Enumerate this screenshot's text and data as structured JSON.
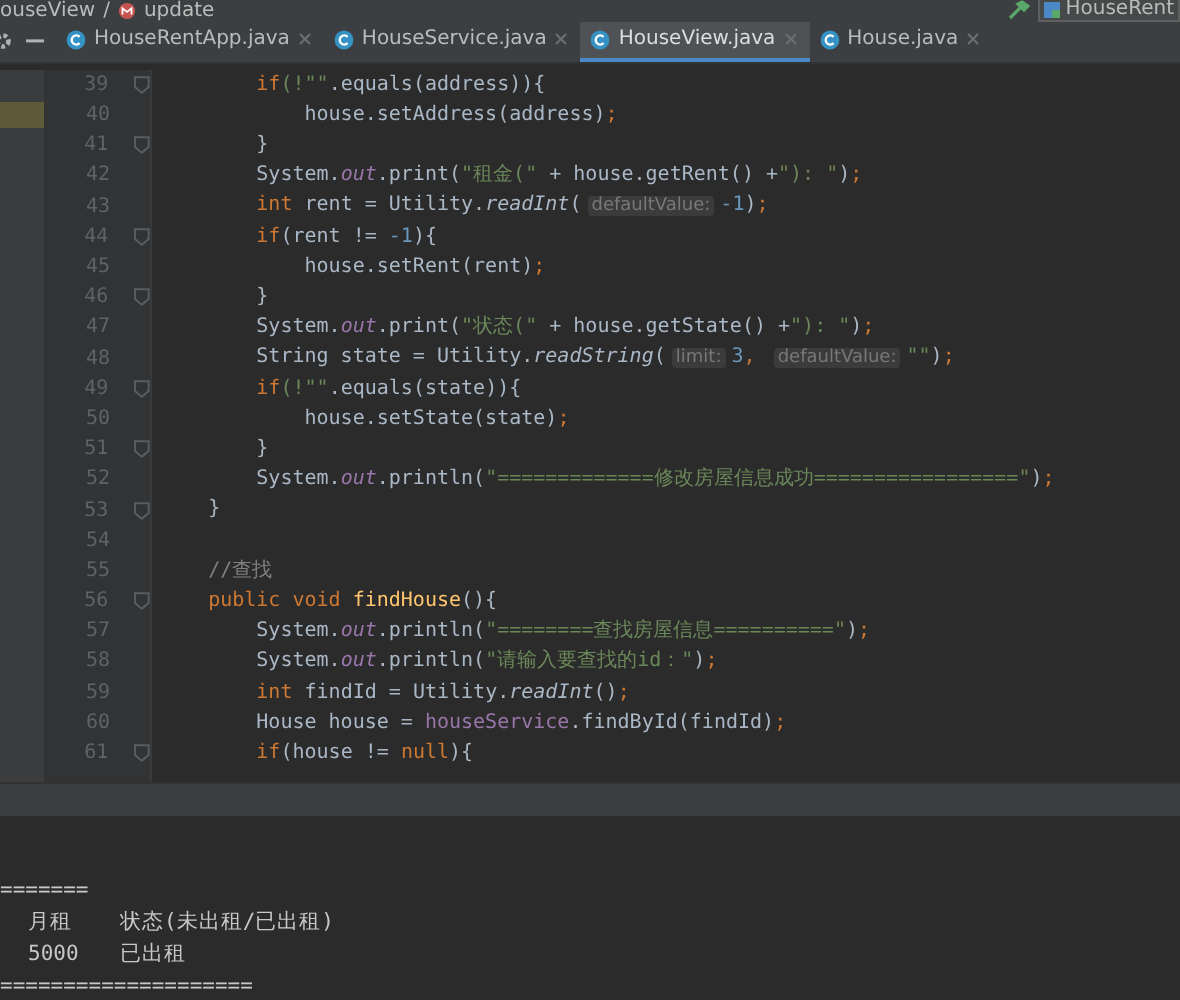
{
  "breadcrumb": {
    "items": [
      {
        "text": "ouseView",
        "kind": "class"
      },
      {
        "text": "update",
        "kind": "method"
      }
    ],
    "separator": "/",
    "run_config": "HouseRent"
  },
  "tabs": [
    {
      "label": "HouseRentApp.java",
      "selected": false
    },
    {
      "label": "HouseService.java",
      "selected": false
    },
    {
      "label": "HouseView.java",
      "selected": true
    },
    {
      "label": "House.java",
      "selected": false
    }
  ],
  "editor": {
    "lines": [
      {
        "number": "39",
        "fold": true,
        "tokens": [
          {
            "t": "        if",
            "kind": "kw"
          },
          {
            "t": "(!\"\"",
            "kind": "str"
          },
          {
            "t": ".equals(address)){",
            "kind": "plain"
          }
        ]
      },
      {
        "number": "40",
        "marked": true,
        "tokens": [
          {
            "t": "            house.setAddress(address)",
            "kind": "plain"
          },
          {
            "t": ";",
            "kind": "kw"
          }
        ]
      },
      {
        "number": "41",
        "fold": true,
        "tokens": [
          {
            "t": "        }",
            "kind": "plain"
          }
        ]
      },
      {
        "number": "42",
        "tokens": [
          {
            "t": "        System.",
            "kind": "plain"
          },
          {
            "t": "out",
            "kind": "static"
          },
          {
            "t": ".print(",
            "kind": "plain"
          },
          {
            "t": "\"租金(\"",
            "kind": "str"
          },
          {
            "t": " + house.getRent() +",
            "kind": "plain"
          },
          {
            "t": "\"): \"",
            "kind": "str"
          },
          {
            "t": ")",
            "kind": "plain"
          },
          {
            "t": ";",
            "kind": "kw"
          }
        ]
      },
      {
        "number": "43",
        "tokens": [
          {
            "t": "        int",
            "kind": "kw"
          },
          {
            "t": " rent = Utility.",
            "kind": "plain"
          },
          {
            "t": "readInt",
            "kind": "italic"
          },
          {
            "t": "(",
            "kind": "plain"
          },
          {
            "t": "defaultValue:",
            "kind": "hint"
          },
          {
            "t": "-1",
            "kind": "num"
          },
          {
            "t": ")",
            "kind": "plain"
          },
          {
            "t": ";",
            "kind": "kw"
          }
        ]
      },
      {
        "number": "44",
        "fold": true,
        "tokens": [
          {
            "t": "        if",
            "kind": "kw"
          },
          {
            "t": "(rent != ",
            "kind": "plain"
          },
          {
            "t": "-1",
            "kind": "num"
          },
          {
            "t": "){",
            "kind": "plain"
          }
        ]
      },
      {
        "number": "45",
        "tokens": [
          {
            "t": "            house.setRent(rent)",
            "kind": "plain"
          },
          {
            "t": ";",
            "kind": "kw"
          }
        ]
      },
      {
        "number": "46",
        "fold": true,
        "tokens": [
          {
            "t": "        }",
            "kind": "plain"
          }
        ]
      },
      {
        "number": "47",
        "tokens": [
          {
            "t": "        System.",
            "kind": "plain"
          },
          {
            "t": "out",
            "kind": "static"
          },
          {
            "t": ".print(",
            "kind": "plain"
          },
          {
            "t": "\"状态(\"",
            "kind": "str"
          },
          {
            "t": " + house.getState() +",
            "kind": "plain"
          },
          {
            "t": "\"): \"",
            "kind": "str"
          },
          {
            "t": ")",
            "kind": "plain"
          },
          {
            "t": ";",
            "kind": "kw"
          }
        ]
      },
      {
        "number": "48",
        "tokens": [
          {
            "t": "        String state = Utility.",
            "kind": "plain"
          },
          {
            "t": "readString",
            "kind": "italic"
          },
          {
            "t": "(",
            "kind": "plain"
          },
          {
            "t": "limit:",
            "kind": "hint"
          },
          {
            "t": "3",
            "kind": "num"
          },
          {
            "t": ", ",
            "kind": "kw"
          },
          {
            "t": "defaultValue:",
            "kind": "hint"
          },
          {
            "t": "\"\"",
            "kind": "str"
          },
          {
            "t": ")",
            "kind": "plain"
          },
          {
            "t": ";",
            "kind": "kw"
          }
        ]
      },
      {
        "number": "49",
        "fold": true,
        "tokens": [
          {
            "t": "        if",
            "kind": "kw"
          },
          {
            "t": "(!\"\"",
            "kind": "str"
          },
          {
            "t": ".equals(state)){",
            "kind": "plain"
          }
        ]
      },
      {
        "number": "50",
        "tokens": [
          {
            "t": "            house.setState(state)",
            "kind": "plain"
          },
          {
            "t": ";",
            "kind": "kw"
          }
        ]
      },
      {
        "number": "51",
        "fold": true,
        "tokens": [
          {
            "t": "        }",
            "kind": "plain"
          }
        ]
      },
      {
        "number": "52",
        "tokens": [
          {
            "t": "        System.",
            "kind": "plain"
          },
          {
            "t": "out",
            "kind": "static"
          },
          {
            "t": ".println(",
            "kind": "plain"
          },
          {
            "t": "\"=============修改房屋信息成功=================\"",
            "kind": "str"
          },
          {
            "t": ")",
            "kind": "plain"
          },
          {
            "t": ";",
            "kind": "kw"
          }
        ]
      },
      {
        "number": "53",
        "fold": true,
        "tokens": [
          {
            "t": "    }",
            "kind": "plain"
          }
        ]
      },
      {
        "number": "54"
      },
      {
        "number": "55",
        "tokens": [
          {
            "t": "    //查找",
            "kind": "comment"
          }
        ]
      },
      {
        "number": "56",
        "fold": true,
        "tokens": [
          {
            "t": "    public void ",
            "kind": "kw"
          },
          {
            "t": "findHouse",
            "kind": "decl"
          },
          {
            "t": "(){",
            "kind": "plain"
          }
        ]
      },
      {
        "number": "57",
        "tokens": [
          {
            "t": "        System.",
            "kind": "plain"
          },
          {
            "t": "out",
            "kind": "static"
          },
          {
            "t": ".println(",
            "kind": "plain"
          },
          {
            "t": "\"========查找房屋信息==========\"",
            "kind": "str"
          },
          {
            "t": ")",
            "kind": "plain"
          },
          {
            "t": ";",
            "kind": "kw"
          }
        ]
      },
      {
        "number": "58",
        "tokens": [
          {
            "t": "        System.",
            "kind": "plain"
          },
          {
            "t": "out",
            "kind": "static"
          },
          {
            "t": ".println(",
            "kind": "plain"
          },
          {
            "t": "\"请输入要查找的id：\"",
            "kind": "str"
          },
          {
            "t": ")",
            "kind": "plain"
          },
          {
            "t": ";",
            "kind": "kw"
          }
        ]
      },
      {
        "number": "59",
        "tokens": [
          {
            "t": "        int",
            "kind": "kw"
          },
          {
            "t": " findId = Utility.",
            "kind": "plain"
          },
          {
            "t": "readInt",
            "kind": "italic"
          },
          {
            "t": "()",
            "kind": "plain"
          },
          {
            "t": ";",
            "kind": "kw"
          }
        ]
      },
      {
        "number": "60",
        "tokens": [
          {
            "t": "        House house = ",
            "kind": "plain"
          },
          {
            "t": "houseService",
            "kind": "field"
          },
          {
            "t": ".findById(findId)",
            "kind": "plain"
          },
          {
            "t": ";",
            "kind": "kw"
          }
        ]
      },
      {
        "number": "61",
        "fold": true,
        "tokens": [
          {
            "t": "        if",
            "kind": "kw"
          },
          {
            "t": "(house != ",
            "kind": "plain"
          },
          {
            "t": "null",
            "kind": "kw"
          },
          {
            "t": "){",
            "kind": "plain"
          }
        ]
      }
    ]
  },
  "console": {
    "rows": [
      [
        "======="
      ],
      [
        "月租",
        "状态(未出租/已出租)"
      ],
      [
        "5000",
        "已出租"
      ],
      [
        "===================="
      ]
    ]
  }
}
